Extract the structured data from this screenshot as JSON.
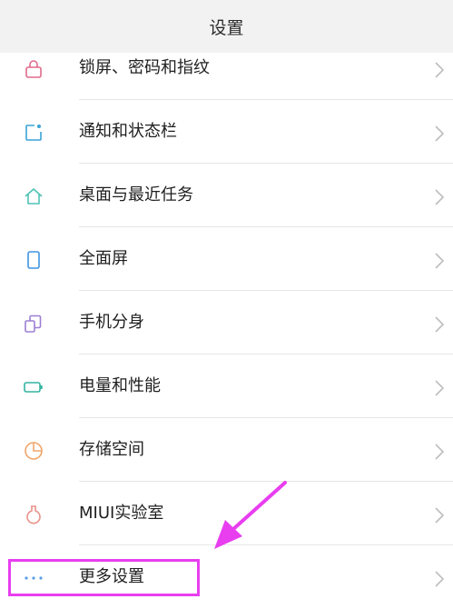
{
  "header": {
    "title": "设置"
  },
  "items": [
    {
      "label": "锁屏、密码和指纹",
      "icon": "lock-icon",
      "color": "#e06b8b"
    },
    {
      "label": "通知和状态栏",
      "icon": "notification-icon",
      "color": "#3aa3d6"
    },
    {
      "label": "桌面与最近任务",
      "icon": "home-icon",
      "color": "#4fc2b5"
    },
    {
      "label": "全面屏",
      "icon": "phone-icon",
      "color": "#3f94e2"
    },
    {
      "label": "手机分身",
      "icon": "clone-icon",
      "color": "#9b7fd4"
    },
    {
      "label": "电量和性能",
      "icon": "battery-icon",
      "color": "#32b3a0"
    },
    {
      "label": "存储空间",
      "icon": "pie-chart-icon",
      "color": "#f0a56b"
    },
    {
      "label": "MIUI实验室",
      "icon": "flask-icon",
      "color": "#e8948c"
    },
    {
      "label": "更多设置",
      "icon": "more-icon",
      "color": "#5b9de6"
    }
  ],
  "annotation": {
    "color": "#e83ef0"
  }
}
